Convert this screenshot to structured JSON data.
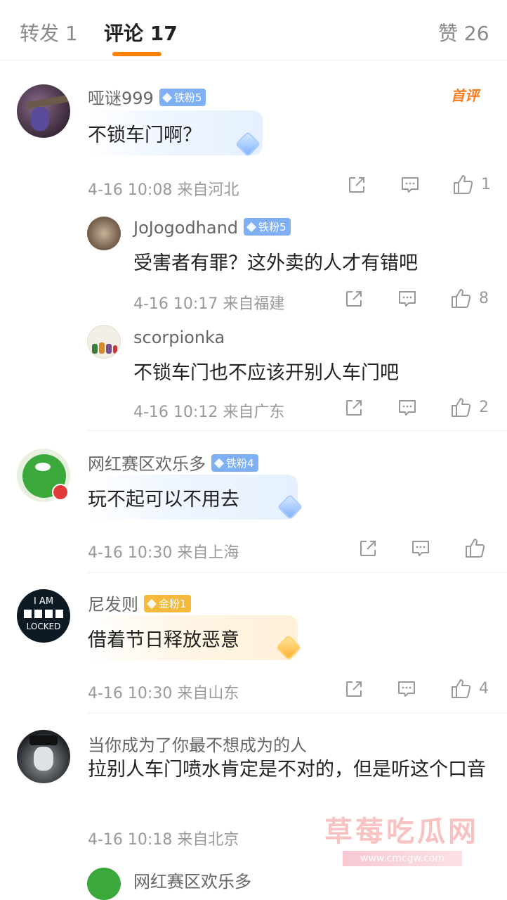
{
  "tabs": {
    "repost": "转发 1",
    "comments": "评论 17",
    "likes": "赞 26"
  },
  "first_comment_tag": "首评",
  "comments": [
    {
      "user": "哑谜999",
      "badge": "铁粉5",
      "text": "不锁车门啊？",
      "meta": "4-16 10:08  来自河北",
      "likes": "1"
    },
    {
      "user": "JoJogodhand",
      "badge": "铁粉5",
      "text": "受害者有罪？这外卖的人才有错吧",
      "meta": "4-16 10:17  来自福建",
      "likes": "8"
    },
    {
      "user": "scorpionka",
      "text": "不锁车门也不应该开别人车门吧",
      "meta": "4-16 10:12  来自广东",
      "likes": "2"
    },
    {
      "user": "网红赛区欢乐多",
      "badge": "铁粉4",
      "text": "玩不起可以不用去",
      "meta": "4-16 10:30  来自上海",
      "likes": ""
    },
    {
      "user": "尼发则",
      "badge": "金粉1",
      "text": "借着节日释放恶意",
      "meta": "4-16 10:30  来自山东",
      "likes": "4"
    },
    {
      "user": "当你成为了你最不想成为的人",
      "text": "拉别人车门喷水肯定是不对的，但是听这个口音",
      "meta": "4-16 10:18  来自北京"
    },
    {
      "user": "网红赛区欢乐多"
    }
  ],
  "avatar_text": {
    "locked_line1": "I AM",
    "locked_line2": "LOCKED"
  },
  "watermark": {
    "title": "草莓吃瓜网",
    "url": "www.cmcgw.com"
  },
  "colors": {
    "accent": "#ff8200",
    "iron_badge": "#7fb0f5",
    "gold_badge": "#f5b93d"
  },
  "icons": [
    "share-icon",
    "comment-icon",
    "like-icon"
  ]
}
